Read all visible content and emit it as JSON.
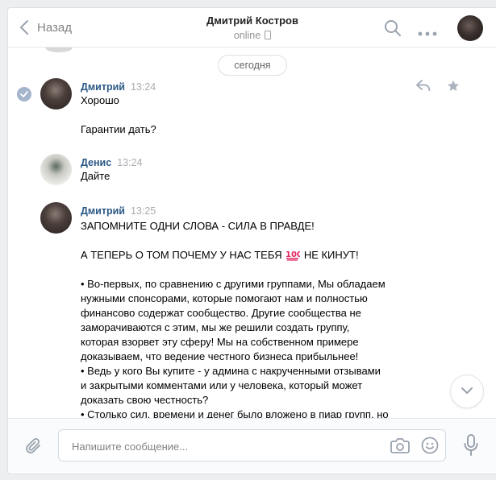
{
  "header": {
    "back_label": "Назад",
    "title": "Дмитрий Костров",
    "status": "online"
  },
  "date_divider": "сегодня",
  "messages": [
    {
      "author": "Дмитрий",
      "time": "13:24",
      "lines": [
        "Хорошо",
        "",
        "Гарантии дать?"
      ]
    },
    {
      "author": "Денис",
      "time": "13:24",
      "lines": [
        "Дайте"
      ]
    },
    {
      "author": "Дмитрий",
      "time": "13:25",
      "line1": "ЗАПОМНИТЕ ОДНИ СЛОВА - СИЛА В ПРАВДЕ!",
      "line2_before": "А ТЕПЕРЬ О ТОМ ПОЧЕМУ У НАС ТЕБЯ ",
      "emoji": "100",
      "line2_after": " НЕ КИНУТ!",
      "body": "• Во-первых, по сравнению с другими группами, Мы обладаем\nнужными спонсорами, которые помогают нам и полностью\nфинансово содержат сообщество. Другие сообщества не\nзаморачиваются с этим, мы же решили создать группу,\nкоторая взорвет эту сферу! Мы на собственном примере\nдоказываем, что ведение честного бизнеса прибыльнее!\n• Ведь у кого Вы купите - у админа с накрученными отзывами\nи закрытыми комментами или у человека, который может\nдоказать свою честность?\n• Столько сил, времени и денег было вложено в пиар групп, но"
    }
  ],
  "composer": {
    "placeholder": "Напишите сообщение..."
  },
  "icons": {
    "back": "chevron-left-icon",
    "search": "search-icon",
    "more": "more-dots-icon",
    "reply": "reply-icon",
    "star": "star-icon",
    "attach": "paperclip-icon",
    "camera": "camera-icon",
    "emoji": "smile-icon",
    "mic": "microphone-icon",
    "scroll": "chevron-down-icon",
    "read": "check-icon"
  },
  "colors": {
    "link": "#2a5885",
    "muted": "#939393",
    "border": "#dce1e6",
    "emoji_red": "#e0245e"
  }
}
